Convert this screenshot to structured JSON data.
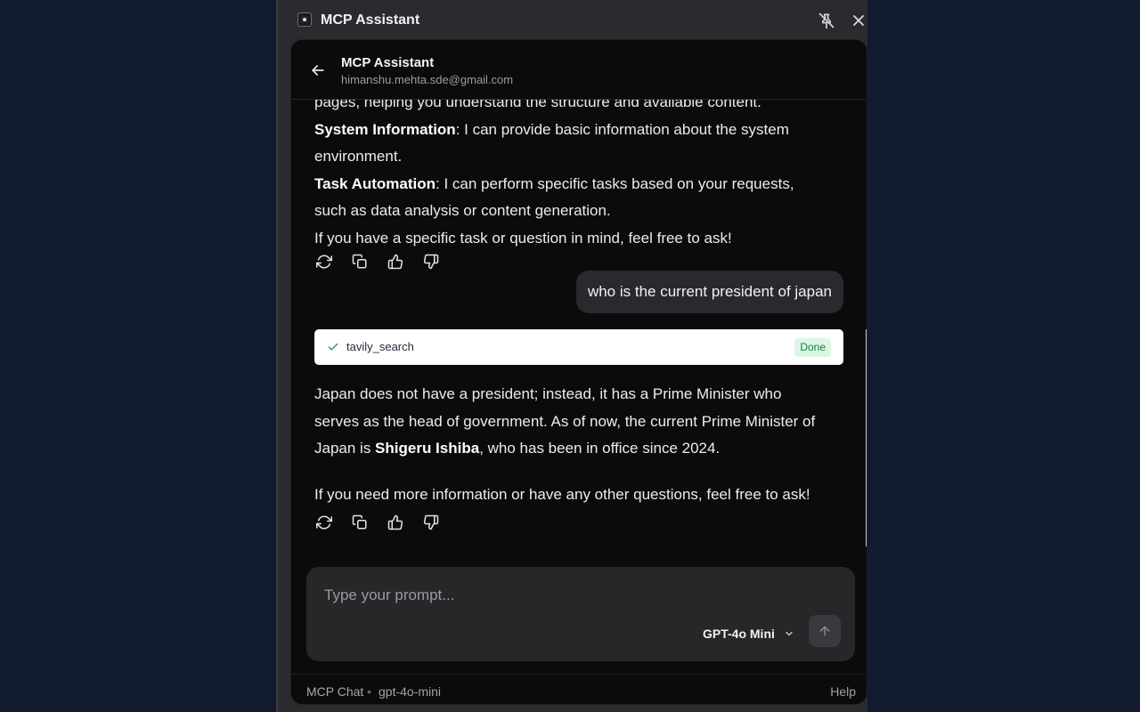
{
  "window": {
    "title": "MCP Assistant",
    "icon": "app-logo-icon"
  },
  "header": {
    "title": "MCP Assistant",
    "email": "himanshu.mehta.sde@gmail.com"
  },
  "messages": {
    "assistant1": {
      "line_cut": "pages, helping you understand the structure and available content.",
      "item1_bold": "System Information",
      "item1_text": ": I can provide basic information about the system environment.",
      "item2_bold": "Task Automation",
      "item2_text": ": I can perform specific tasks based on your requests, such as data analysis or content generation.",
      "closing": "If you have a specific task or question in mind, feel free to ask!"
    },
    "user1": "who is the current president of japan",
    "tool_call": {
      "name": "tavily_search",
      "status": "Done"
    },
    "assistant2": {
      "p1_a": "Japan does not have a president; instead, it has a Prime Minister who serves as the head of government. As of now, the current Prime Minister of Japan is ",
      "p1_bold": "Shigeru Ishiba",
      "p1_b": ", who has been in office since 2024.",
      "p2": "If you need more information or have any other questions, feel free to ask!"
    },
    "action_icons": [
      "refresh-icon",
      "copy-icon",
      "thumbs-up-icon",
      "thumbs-down-icon"
    ]
  },
  "composer": {
    "placeholder": "Type your prompt...",
    "model": "GPT-4o Mini"
  },
  "footer": {
    "app": "MCP Chat",
    "separator": "•",
    "model": "gpt-4o-mini",
    "help": "Help"
  }
}
